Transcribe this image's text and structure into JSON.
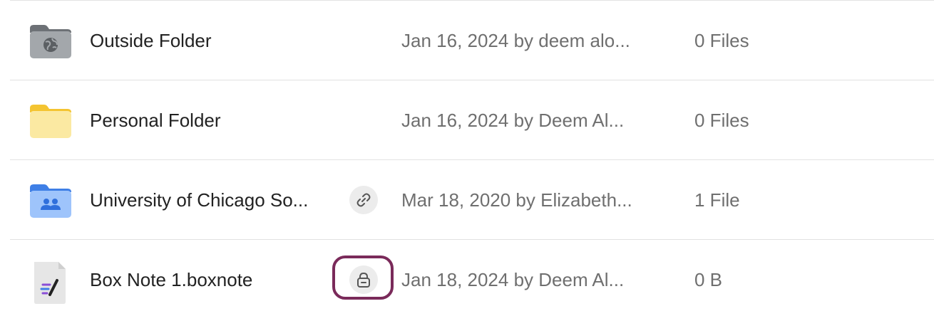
{
  "rows": [
    {
      "name": "Outside Folder",
      "updated": "Jan 16, 2024 by deem alo...",
      "size": "0 Files",
      "icon": "external-folder-icon"
    },
    {
      "name": "Personal Folder",
      "updated": "Jan 16, 2024 by Deem Al...",
      "size": "0 Files",
      "icon": "personal-folder-icon"
    },
    {
      "name": "University of Chicago So...",
      "updated": "Mar 18, 2020 by Elizabeth...",
      "size": "1 File",
      "icon": "collaboration-folder-icon",
      "badge": "shared-link-icon"
    },
    {
      "name": "Box Note 1.boxnote",
      "updated": "Jan 18, 2024 by Deem Al...",
      "size": "0 B",
      "icon": "box-note-icon",
      "badge": "lock-icon"
    }
  ],
  "colors": {
    "external_folder": "#8e9296",
    "personal_folder": "#f7d55a",
    "collab_folder": "#4a8ff0",
    "focus_ring": "#7a2a5a",
    "meta_text": "#6f6f6f"
  }
}
